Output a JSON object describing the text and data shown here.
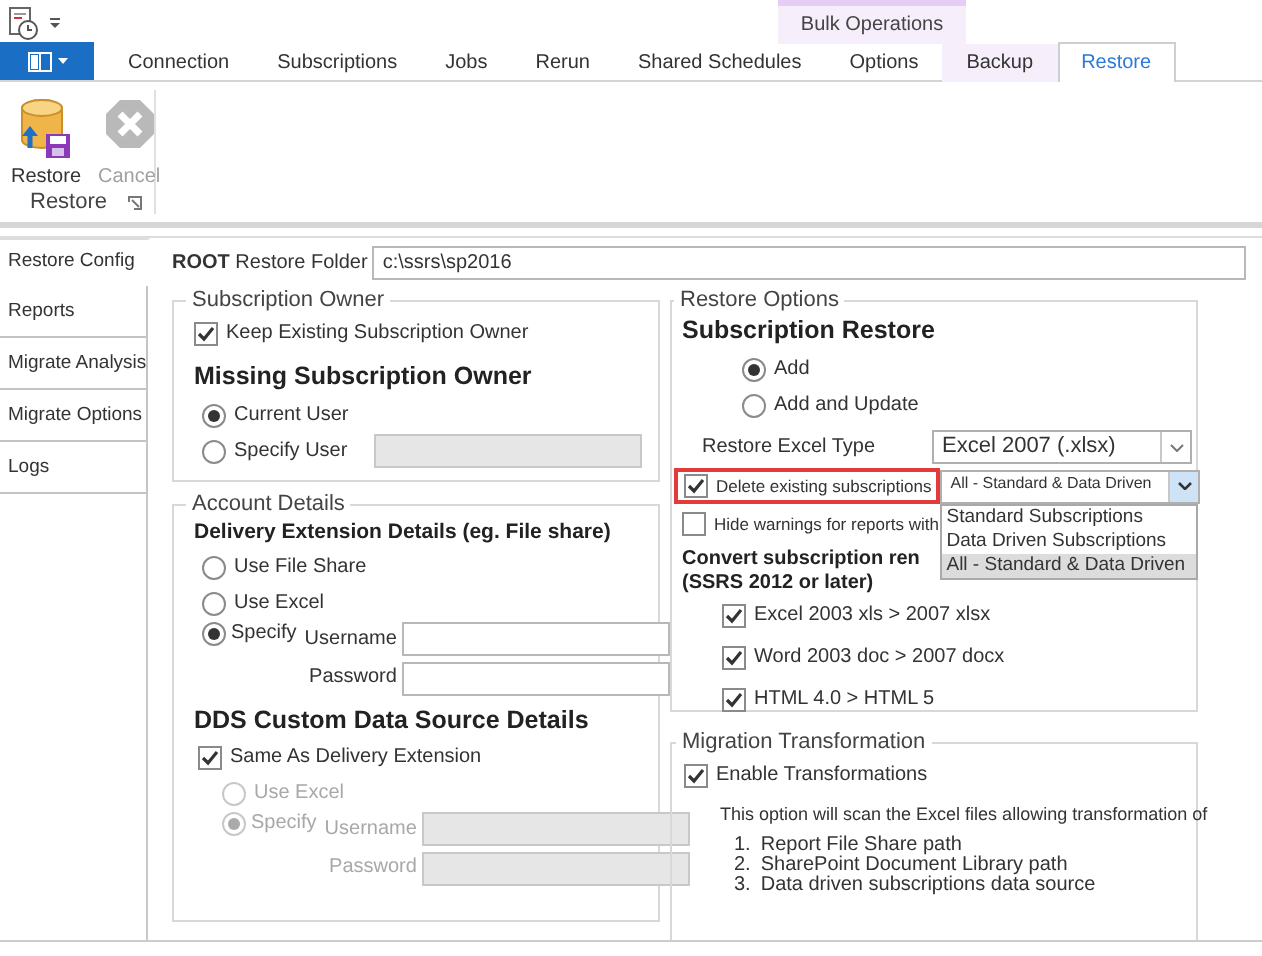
{
  "contextual_group": {
    "label": "Bulk Operations"
  },
  "ribbon_tabs": [
    {
      "label": "Connection",
      "selected": false,
      "contextual": false
    },
    {
      "label": "Subscriptions",
      "selected": false,
      "contextual": false
    },
    {
      "label": "Jobs",
      "selected": false,
      "contextual": false
    },
    {
      "label": "Rerun",
      "selected": false,
      "contextual": false
    },
    {
      "label": "Shared Schedules",
      "selected": false,
      "contextual": false
    },
    {
      "label": "Options",
      "selected": false,
      "contextual": false
    },
    {
      "label": "Backup",
      "selected": false,
      "contextual": true
    },
    {
      "label": "Restore",
      "selected": true,
      "contextual": true
    }
  ],
  "ribbon": {
    "buttons": [
      {
        "label": "Restore",
        "kind": "restore",
        "disabled": false
      },
      {
        "label": "Cancel",
        "kind": "cancel",
        "disabled": true
      }
    ],
    "group_label": "Restore"
  },
  "side_tabs": [
    {
      "label": "Restore Config",
      "selected": true
    },
    {
      "label": "Reports",
      "selected": false
    },
    {
      "label": "Migrate Analysis",
      "selected": false
    },
    {
      "label": "Migrate Options",
      "selected": false
    },
    {
      "label": "Logs",
      "selected": false
    }
  ],
  "root_folder": {
    "label": "**ROOT** Restore Folder",
    "value": "c:\\ssrs\\sp2016"
  },
  "subscription_owner": {
    "title": "Subscription Owner",
    "keep_existing": {
      "label": "Keep Existing Subscription Owner",
      "checked": true
    },
    "heading": "Missing Subscription Owner",
    "options": [
      {
        "label": "Current User",
        "selected": true
      },
      {
        "label": "Specify User",
        "selected": false
      }
    ],
    "user_field_disabled": true
  },
  "account_details": {
    "title": "Account Details",
    "delivery_heading": "Delivery Extension Details (eg. File share)",
    "delivery_options": [
      {
        "label": "Use File Share",
        "selected": false,
        "disabled": false
      },
      {
        "label": "Use Excel",
        "selected": false,
        "disabled": false
      },
      {
        "label": "Specify",
        "selected": true,
        "disabled": false
      }
    ],
    "delivery_fields": [
      {
        "label": "Username",
        "disabled": false
      },
      {
        "label": "Password",
        "disabled": false
      }
    ],
    "dds_heading": "DDS Custom Data Source Details",
    "same_as": {
      "label": "Same As Delivery Extension",
      "checked": true
    },
    "dds_options": [
      {
        "label": "Use Excel",
        "selected": false,
        "disabled": true
      },
      {
        "label": "Specify",
        "selected": true,
        "disabled": true
      }
    ],
    "dds_fields": [
      {
        "label": "Username",
        "disabled": true
      },
      {
        "label": "Password",
        "disabled": true
      }
    ]
  },
  "restore_options": {
    "title": "Restore Options",
    "heading": "Subscription Restore",
    "modes": [
      {
        "label": "Add",
        "selected": true
      },
      {
        "label": "Add and Update",
        "selected": false
      }
    ],
    "excel_type": {
      "label": "Restore Excel Type",
      "value": "Excel 2007 (.xlsx)"
    },
    "delete_existing": {
      "label": "Delete existing subscriptions",
      "checked": true,
      "highlighted": true
    },
    "delete_scope": {
      "value": "All - Standard & Data Driven",
      "expanded": true,
      "options": [
        {
          "label": "Standard Subscriptions",
          "selected": false
        },
        {
          "label": "Data Driven Subscriptions",
          "selected": false
        },
        {
          "label": "All - Standard & Data Driven",
          "selected": true
        }
      ]
    },
    "hide_warnings": {
      "label": "Hide warnings for reports with",
      "checked": false
    },
    "convert_heading": [
      "Convert subscription ren",
      "(SSRS 2012 or later)"
    ],
    "conversions": [
      {
        "label": "Excel 2003 xls > 2007 xlsx",
        "checked": true
      },
      {
        "label": "Word 2003 doc > 2007 docx",
        "checked": true
      },
      {
        "label": "HTML 4.0 > HTML 5",
        "checked": true
      }
    ]
  },
  "migration_transformation": {
    "title": "Migration Transformation",
    "enable": {
      "label": "Enable Transformations",
      "checked": true
    },
    "description": "This option will scan the Excel files allowing transformation of",
    "items": [
      {
        "number": "1.",
        "text": "Report File Share path"
      },
      {
        "number": "2.",
        "text": "SharePoint Document Library path"
      },
      {
        "number": "3.",
        "text": "Data driven subscriptions data source"
      }
    ]
  }
}
